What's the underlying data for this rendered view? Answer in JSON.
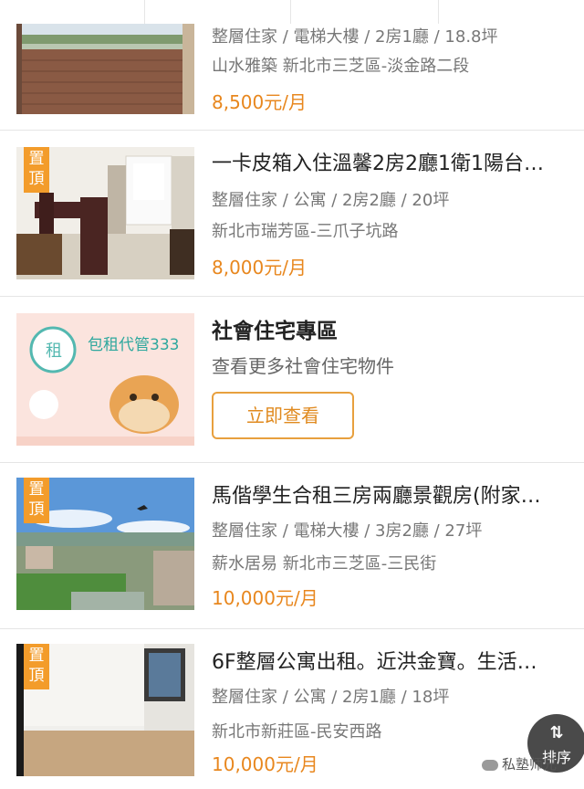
{
  "listings": [
    {
      "title": "",
      "meta": "整層住家 / 電梯大樓 / 2房1廳 / 18.8坪",
      "location": "山水雅築 新北市三芝區-淡金路二段",
      "price": "8,500元/月",
      "pinned": false
    },
    {
      "title": "一卡皮箱入住溫馨2房2廳1衛1陽台…",
      "meta": "整層住家 / 公寓 / 2房2廳 / 20坪",
      "location": "新北市瑞芳區-三爪子坑路",
      "price": "8,000元/月",
      "pinned": true,
      "pin_label": "置頂"
    },
    {
      "title": "馬偕學生合租三房兩廳景觀房(附家…",
      "meta": "整層住家 / 電梯大樓 / 3房2廳 / 27坪",
      "location": "薪水居易 新北市三芝區-三民街",
      "price": "10,000元/月",
      "pinned": true,
      "pin_label": "置頂"
    },
    {
      "title": "6F整層公寓出租。近洪金寶。生活…",
      "meta": "整層住家 / 公寓 / 2房1廳 / 18坪",
      "location": "新北市新莊區-民安西路",
      "price": "10,000元/月",
      "pinned": true,
      "pin_label": "置頂"
    }
  ],
  "promo": {
    "title": "社會住宅專區",
    "subtitle": "查看更多社會住宅物件",
    "button_label": "立即查看",
    "banner_text": "包租代管333"
  },
  "sort_button": {
    "icon": "sort-arrows-icon",
    "glyph": "⇅",
    "label": "排序"
  },
  "watermark": "私塾师兄",
  "colors": {
    "accent": "#e8871e",
    "pin": "#f39c2b",
    "text": "#222222",
    "muted": "#777777"
  }
}
